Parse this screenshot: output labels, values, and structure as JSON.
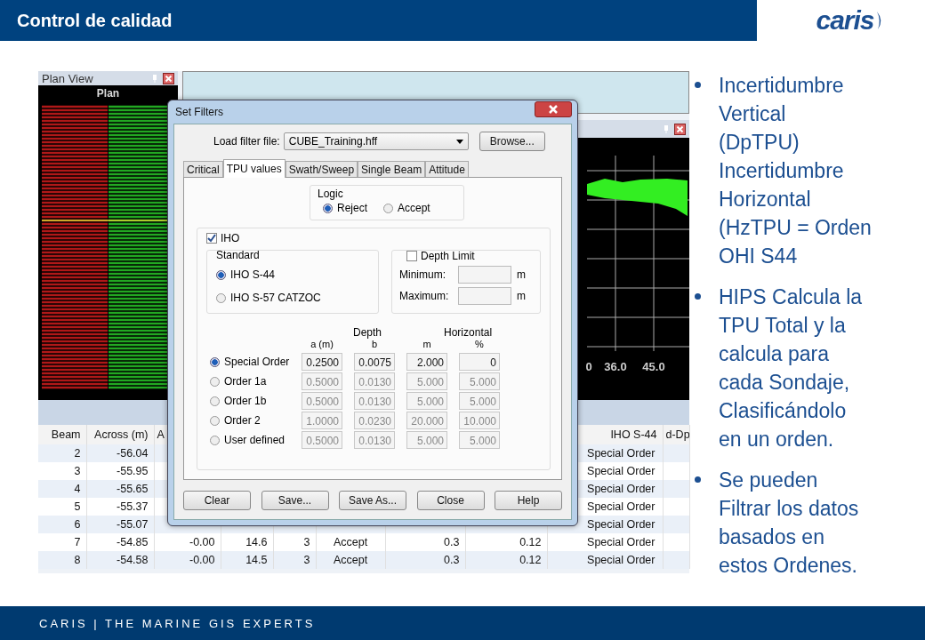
{
  "header": {
    "title": "Control de calidad",
    "logo": "caris"
  },
  "plan_view": {
    "title": "Plan View",
    "plot_title": "Plan"
  },
  "profile_panel": {
    "tick_labels": [
      "0",
      "36.0",
      "45.0"
    ]
  },
  "table": {
    "columns": [
      "Beam",
      "Across (m)",
      "A",
      null,
      null,
      null,
      null,
      null,
      "IHO S-44",
      "d-Dp"
    ],
    "rows": [
      {
        "cells": [
          "2",
          "-56.04",
          null,
          null,
          null,
          null,
          null,
          null,
          "Special Order",
          null
        ]
      },
      {
        "cells": [
          "3",
          "-55.95",
          null,
          null,
          null,
          null,
          null,
          null,
          "Special Order",
          null
        ]
      },
      {
        "cells": [
          "4",
          "-55.65",
          null,
          null,
          null,
          null,
          null,
          null,
          "Special Order",
          null
        ]
      },
      {
        "cells": [
          "5",
          "-55.37",
          null,
          null,
          null,
          null,
          null,
          null,
          "Special Order",
          null
        ]
      },
      {
        "cells": [
          "6",
          "-55.07",
          null,
          null,
          null,
          null,
          null,
          null,
          "Special Order",
          null
        ]
      },
      {
        "cells": [
          "7",
          "-54.85",
          "-0.00",
          "14.6",
          "3",
          "Accept",
          "0.3",
          "0.12",
          "Special Order",
          null
        ]
      },
      {
        "cells": [
          "8",
          "-54.58",
          "-0.00",
          "14.5",
          "3",
          "Accept",
          "0.3",
          "0.12",
          "Special Order",
          null
        ]
      }
    ]
  },
  "dialog": {
    "title": "Set Filters",
    "load_filter": {
      "label": "Load filter file:",
      "value": "CUBE_Training.hff"
    },
    "browse_button": "Browse...",
    "tabs": [
      {
        "label": "Critical",
        "selected": false
      },
      {
        "label": "TPU values",
        "selected": true
      },
      {
        "label": "Swath/Sweep",
        "selected": false
      },
      {
        "label": "Single Beam",
        "selected": false
      },
      {
        "label": "Attitude",
        "selected": false
      }
    ],
    "logic": {
      "title": "Logic",
      "options": [
        {
          "label": "Reject",
          "selected": true
        },
        {
          "label": "Accept",
          "selected": false
        }
      ]
    },
    "iho": {
      "label": "IHO",
      "checked": true
    },
    "standard": {
      "title": "Standard",
      "options": [
        {
          "label": "IHO S-44",
          "selected": true
        },
        {
          "label": "IHO S-57 CATZOC",
          "selected": false
        }
      ]
    },
    "depth_limit": {
      "label": "Depth Limit",
      "checked": false,
      "fields": [
        {
          "label": "Minimum:",
          "unit": "m"
        },
        {
          "label": "Maximum:",
          "unit": "m"
        }
      ]
    },
    "orders": {
      "group_headers": [
        "Depth",
        "Horizontal"
      ],
      "columns": [
        "a (m)",
        "b",
        "m",
        "%"
      ],
      "rows": [
        {
          "label": "Special Order",
          "selected": true,
          "values": [
            "0.2500",
            "0.0075",
            "2.000",
            "0"
          ]
        },
        {
          "label": "Order 1a",
          "selected": false,
          "values": [
            "0.5000",
            "0.0130",
            "5.000",
            "5.000"
          ]
        },
        {
          "label": "Order 1b",
          "selected": false,
          "values": [
            "0.5000",
            "0.0130",
            "5.000",
            "5.000"
          ]
        },
        {
          "label": "Order 2",
          "selected": false,
          "values": [
            "1.0000",
            "0.0230",
            "20.000",
            "10.000"
          ]
        },
        {
          "label": "User defined",
          "selected": false,
          "values": [
            "0.5000",
            "0.0130",
            "5.000",
            "5.000"
          ]
        }
      ]
    },
    "buttons": [
      "Clear",
      "Save...",
      "Save As...",
      "Close",
      "Help"
    ]
  },
  "bullets": [
    "Incertidumbre Vertical (DpTPU) Incertidumbre Horizontal (HzTPU = Orden OHI S44",
    "HIPS Calcula la TPU Total y la calcula para cada Sondaje, Clasificándolo en un orden.",
    "Se pueden Filtrar los datos basados en estos Ordenes."
  ],
  "footer": {
    "text": "CARIS | THE MARINE GIS EXPERTS"
  }
}
